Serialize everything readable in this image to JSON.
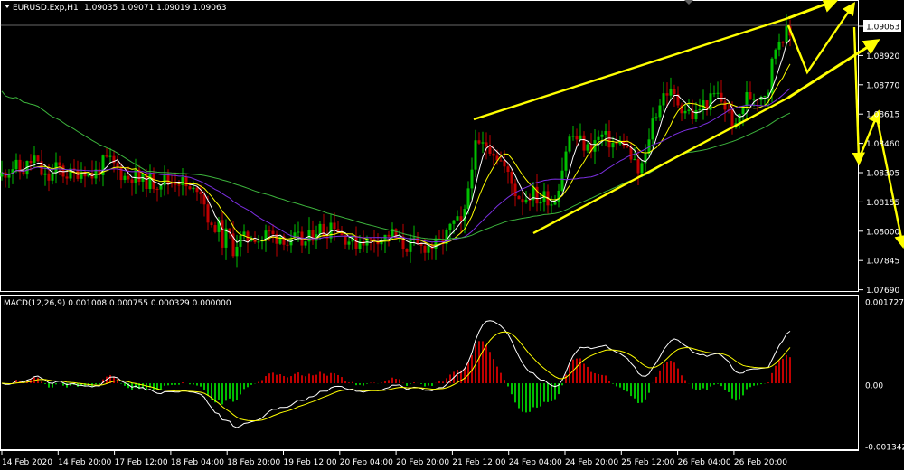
{
  "header": {
    "symbol": "EURUSD.Exp,H1",
    "ohlc": "1.09035 1.09071 1.09019 1.09063"
  },
  "macd_header": {
    "label": "MACD(12,26,9) 0.001008 0.000755 0.000329 0.000000"
  },
  "colors": {
    "background": "#000000",
    "bull_candle": "#00c000",
    "bear_candle": "#c00000",
    "ma_fast": "#ffffff",
    "ma_mid": "#ffff00",
    "ma_slow": "#7b2fe0",
    "ma_long": "#3cb33c",
    "annotation": "#ffff00",
    "macd_line": "#ffffff",
    "macd_signal": "#ffff00",
    "grid": "#ffffff"
  },
  "chart_data": [
    {
      "type": "candlestick",
      "title": "EURUSD.Exp,H1",
      "price_axis_ticks": [
        "1.09063",
        "1.08920",
        "1.08770",
        "1.08615",
        "1.08460",
        "1.08305",
        "1.08155",
        "1.08000",
        "1.07845",
        "1.07690"
      ],
      "current_price": "1.09063",
      "ylim": [
        1.0769,
        1.0912
      ],
      "time_axis_ticks": [
        "14 Feb 2020",
        "14 Feb 20:00",
        "17 Feb 12:00",
        "18 Feb 04:00",
        "18 Feb 20:00",
        "19 Feb 12:00",
        "20 Feb 04:00",
        "20 Feb 20:00",
        "21 Feb 12:00",
        "24 Feb 04:00",
        "24 Feb 20:00",
        "25 Feb 12:00",
        "26 Feb 04:00",
        "26 Feb 20:00"
      ],
      "close_path": [
        [
          0,
          1.083
        ],
        [
          8,
          1.0834
        ],
        [
          16,
          1.0836
        ],
        [
          24,
          1.0832
        ],
        [
          30,
          1.0836
        ],
        [
          38,
          1.084
        ],
        [
          44,
          1.0833
        ],
        [
          52,
          1.0828
        ],
        [
          58,
          1.0831
        ],
        [
          64,
          1.0836
        ],
        [
          70,
          1.0832
        ],
        [
          78,
          1.0831
        ],
        [
          86,
          1.0833
        ],
        [
          94,
          1.0834
        ],
        [
          100,
          1.083
        ],
        [
          108,
          1.0833
        ],
        [
          114,
          1.0837
        ],
        [
          120,
          1.0839
        ],
        [
          126,
          1.0836
        ],
        [
          132,
          1.0833
        ],
        [
          140,
          1.0829
        ],
        [
          148,
          1.0831
        ],
        [
          156,
          1.0827
        ],
        [
          164,
          1.0828
        ],
        [
          172,
          1.0826
        ],
        [
          180,
          1.0829
        ],
        [
          188,
          1.0827
        ],
        [
          196,
          1.0829
        ],
        [
          204,
          1.0826
        ],
        [
          212,
          1.082
        ],
        [
          220,
          1.0827
        ],
        [
          228,
          1.0812
        ],
        [
          234,
          1.08
        ],
        [
          240,
          1.0806
        ],
        [
          246,
          1.0795
        ],
        [
          252,
          1.08
        ],
        [
          258,
          1.0791
        ],
        [
          264,
          1.0796
        ],
        [
          272,
          1.0796
        ],
        [
          280,
          1.0799
        ],
        [
          288,
          1.0795
        ],
        [
          296,
          1.08
        ],
        [
          304,
          1.0797
        ],
        [
          312,
          1.0799
        ],
        [
          320,
          1.0792
        ],
        [
          328,
          1.0797
        ],
        [
          336,
          1.0793
        ],
        [
          344,
          1.0798
        ],
        [
          352,
          1.0803
        ],
        [
          360,
          1.0799
        ],
        [
          368,
          1.0807
        ],
        [
          376,
          1.0799
        ],
        [
          384,
          1.0797
        ],
        [
          392,
          1.0793
        ],
        [
          400,
          1.0797
        ],
        [
          408,
          1.0794
        ],
        [
          416,
          1.0798
        ],
        [
          424,
          1.0796
        ],
        [
          432,
          1.08
        ],
        [
          440,
          1.0795
        ],
        [
          448,
          1.0792
        ],
        [
          456,
          1.0794
        ],
        [
          464,
          1.0791
        ],
        [
          472,
          1.0793
        ],
        [
          480,
          1.0792
        ],
        [
          488,
          1.0794
        ],
        [
          496,
          1.08
        ],
        [
          504,
          1.0806
        ],
        [
          512,
          1.0802
        ],
        [
          518,
          1.0824
        ],
        [
          524,
          1.0845
        ],
        [
          532,
          1.0846
        ],
        [
          540,
          1.0848
        ],
        [
          548,
          1.0843
        ],
        [
          556,
          1.0837
        ],
        [
          564,
          1.0828
        ],
        [
          572,
          1.082
        ],
        [
          580,
          1.0818
        ],
        [
          588,
          1.0822
        ],
        [
          596,
          1.0817
        ],
        [
          604,
          1.082
        ],
        [
          612,
          1.0815
        ],
        [
          620,
          1.083
        ],
        [
          628,
          1.085
        ],
        [
          634,
          1.0852
        ],
        [
          642,
          1.0849
        ],
        [
          650,
          1.0845
        ],
        [
          658,
          1.0849
        ],
        [
          666,
          1.0852
        ],
        [
          674,
          1.0849
        ],
        [
          682,
          1.0847
        ],
        [
          690,
          1.0849
        ],
        [
          698,
          1.084
        ],
        [
          706,
          1.0832
        ],
        [
          714,
          1.084
        ],
        [
          720,
          1.0858
        ],
        [
          728,
          1.0868
        ],
        [
          736,
          1.0877
        ],
        [
          744,
          1.0874
        ],
        [
          752,
          1.0869
        ],
        [
          760,
          1.0866
        ],
        [
          768,
          1.0862
        ],
        [
          776,
          1.0869
        ],
        [
          784,
          1.087
        ],
        [
          792,
          1.0875
        ],
        [
          800,
          1.087
        ],
        [
          808,
          1.0862
        ],
        [
          814,
          1.0855
        ],
        [
          820,
          1.0868
        ],
        [
          826,
          1.0873
        ],
        [
          834,
          1.0874
        ],
        [
          842,
          1.0875
        ],
        [
          850,
          1.0878
        ],
        [
          856,
          1.0898
        ],
        [
          862,
          1.0905
        ],
        [
          868,
          1.0908
        ],
        [
          874,
          1.0906
        ]
      ]
    },
    {
      "type": "macd",
      "title": "MACD(12,26,9) 0.001008 0.000755 0.000329 0.000000",
      "axis_ticks": [
        "0.001727",
        "0.00",
        "-0.001342"
      ],
      "ylim": [
        -0.001342,
        0.001727
      ]
    }
  ]
}
